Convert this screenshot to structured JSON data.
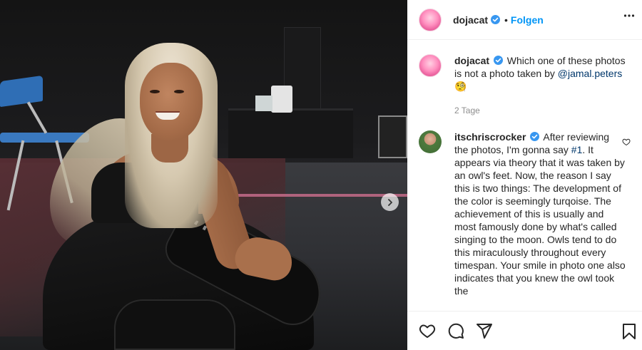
{
  "header": {
    "username": "dojacat",
    "separator": "•",
    "follow_label": "Folgen",
    "more_icon": "more-horizontal-icon"
  },
  "caption": {
    "username": "dojacat",
    "text": "Which one of these photos is not a photo taken by",
    "mention": "@jamal.peters",
    "emoji": "🧐",
    "time": "2 Tage"
  },
  "comment": {
    "username": "itschriscrocker",
    "text_before": "After reviewing the photos, I'm gonna say",
    "hashtag": "#1",
    "text_after": ". It appears via theory that it was taken by an owl's feet. Now, the reason I say this is two things: The development of the color is seemingly turqoise. The achievement of this is usually and most famously done by what's called singing to the moon. Owls tend to do this miraculously throughout every timespan. Your smile in photo one also indicates that you knew the owl took the"
  },
  "actions": {
    "like_icon": "heart-icon",
    "comment_icon": "comment-icon",
    "share_icon": "paper-plane-icon",
    "save_icon": "bookmark-icon"
  },
  "colors": {
    "link_blue": "#0095f6",
    "mention_blue": "#00376b",
    "verified_blue": "#3897f0",
    "muted": "#8e8e8e"
  }
}
